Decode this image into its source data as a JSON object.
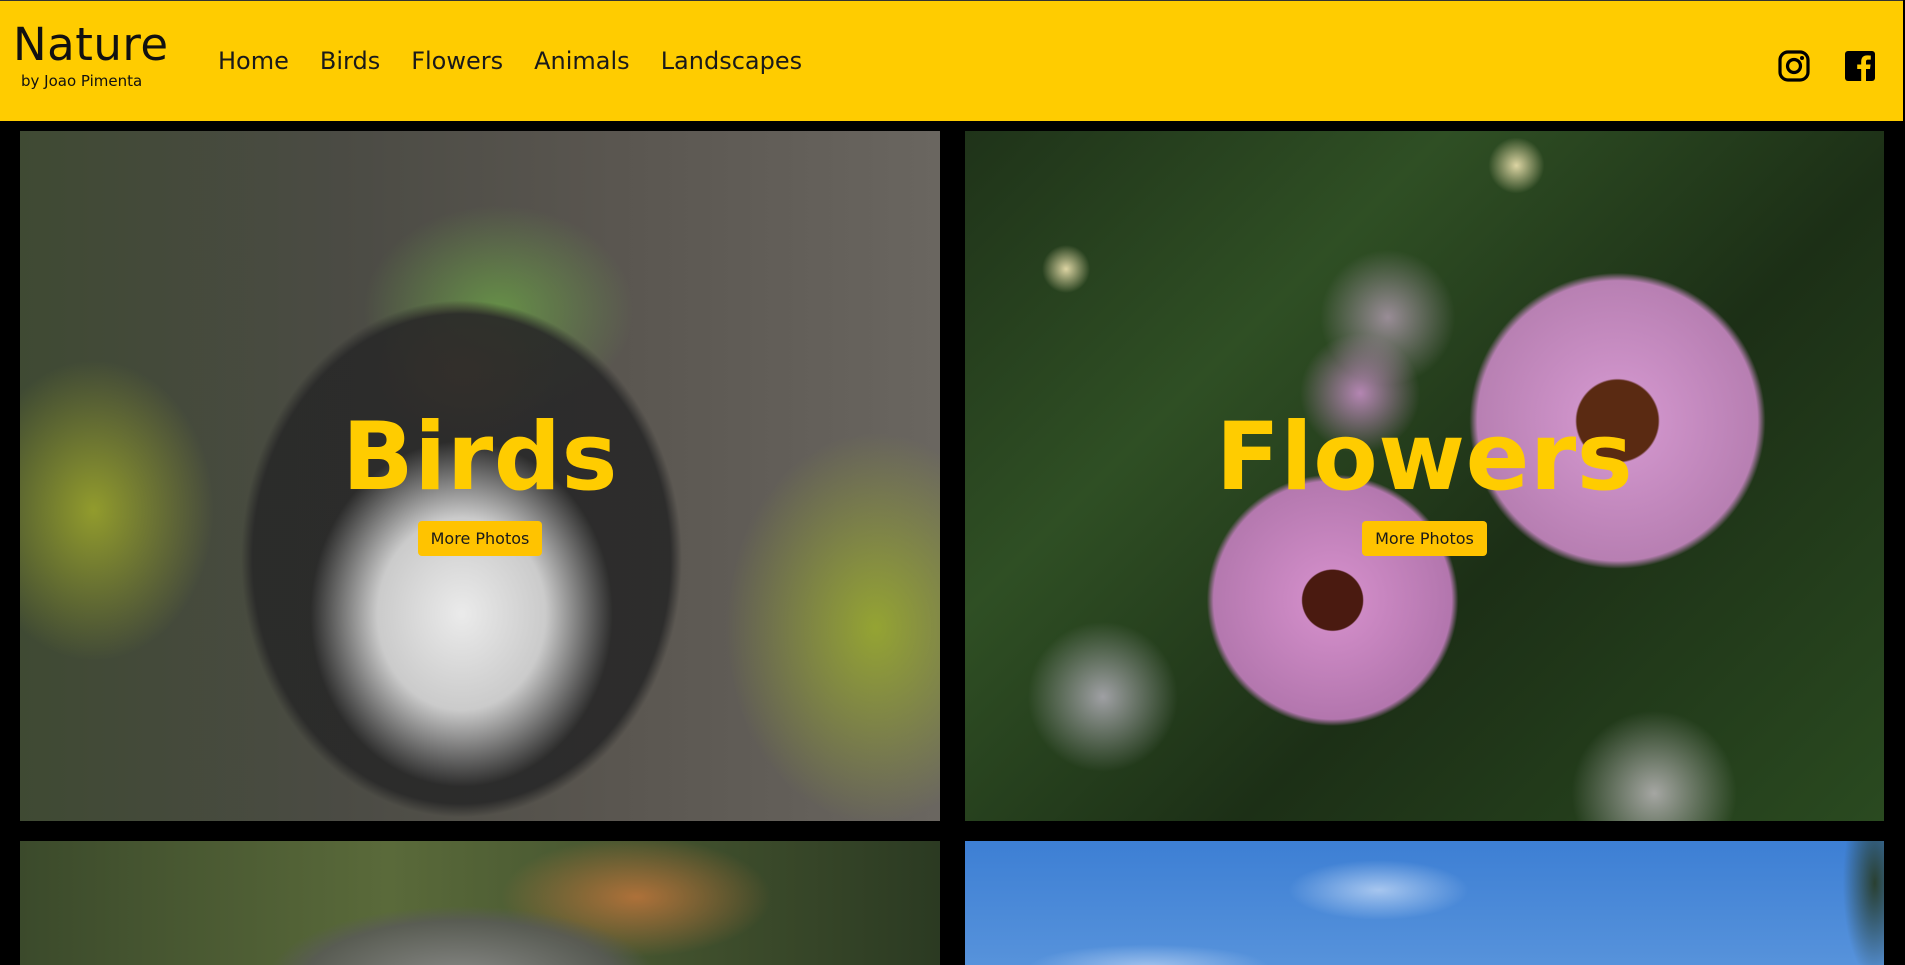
{
  "brand": {
    "title": "Nature",
    "subtitle": "by Joao Pimenta"
  },
  "nav": {
    "items": [
      {
        "label": "Home"
      },
      {
        "label": "Birds"
      },
      {
        "label": "Flowers"
      },
      {
        "label": "Animals"
      },
      {
        "label": "Landscapes"
      }
    ]
  },
  "social": {
    "instagram_icon": "instagram-icon",
    "facebook_icon": "facebook-icon"
  },
  "gallery": {
    "cards": [
      {
        "title": "Birds",
        "button_label": "More Photos",
        "image": "owl-photo"
      },
      {
        "title": "Flowers",
        "button_label": "More Photos",
        "image": "flowers-photo"
      },
      {
        "image": "iguana-photo"
      },
      {
        "image": "sky-photo"
      }
    ]
  },
  "colors": {
    "header_bg": "#ffcc00",
    "accent": "#ffcc00",
    "button_bg": "#ffc300",
    "page_bg": "#000000"
  }
}
